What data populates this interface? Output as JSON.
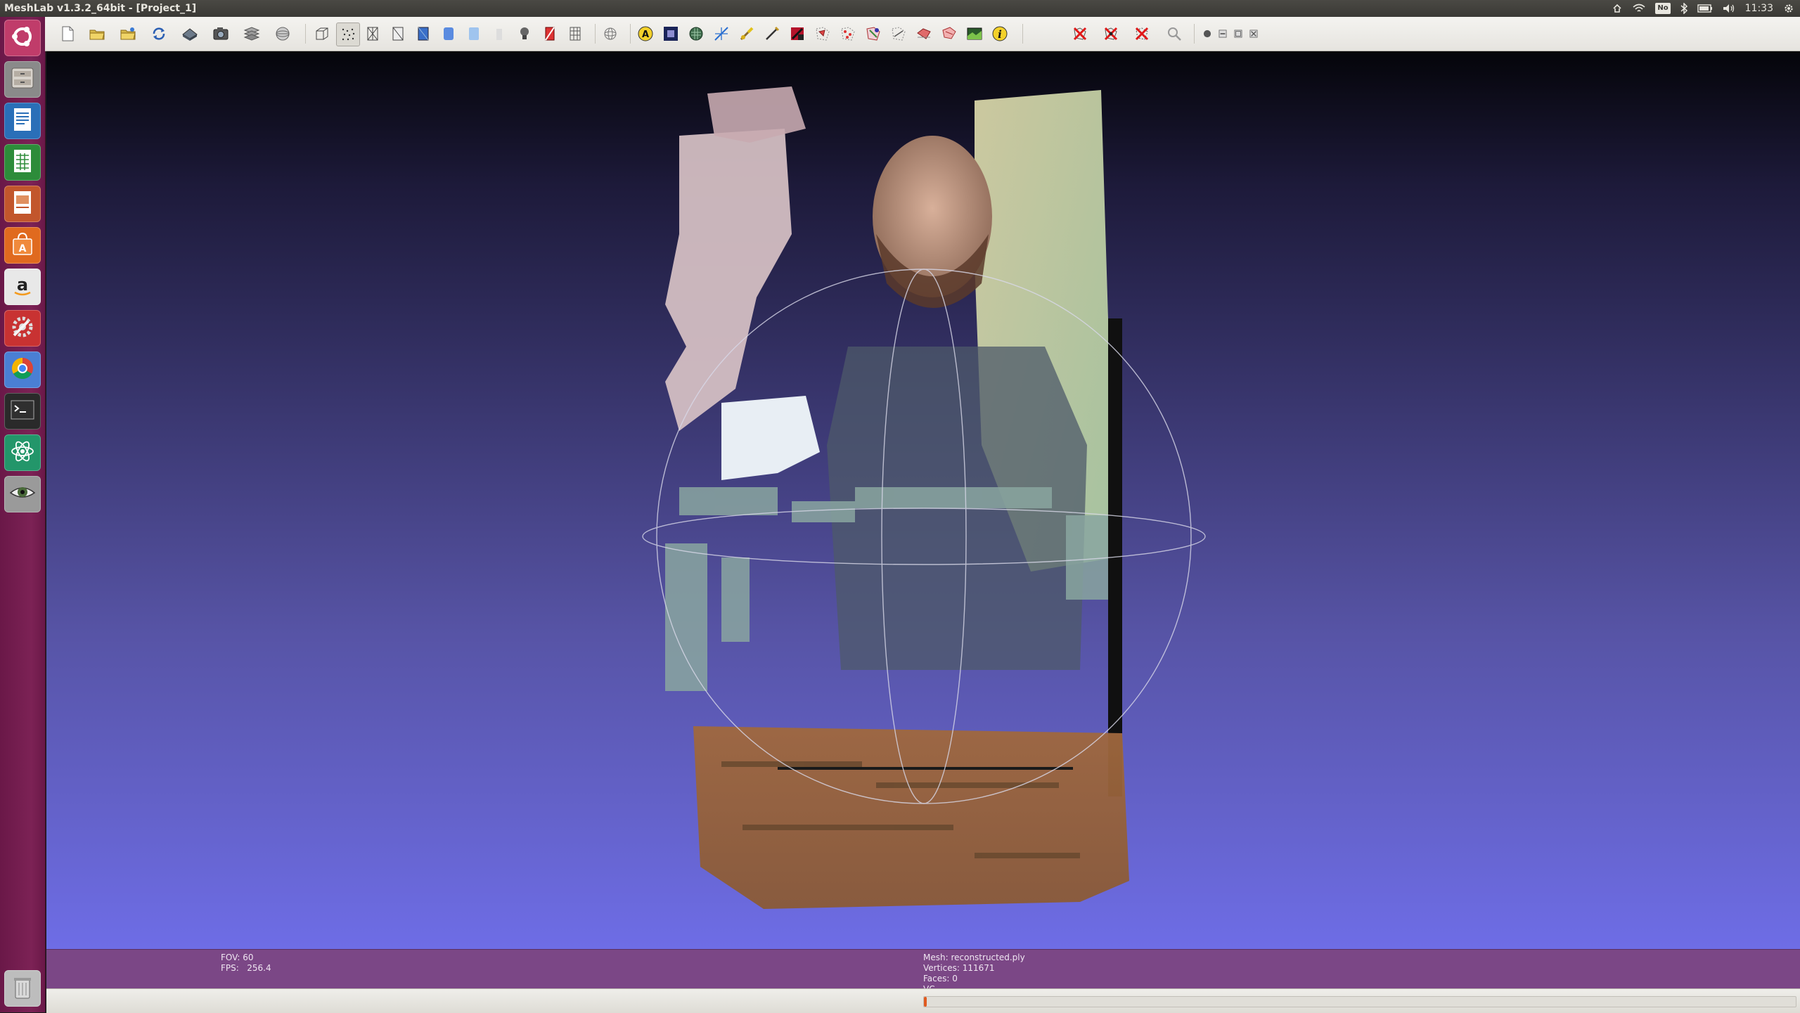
{
  "window": {
    "title": "MeshLab v1.3.2_64bit - [Project_1]"
  },
  "system_tray": {
    "items": [
      "network-settings-icon",
      "wifi-icon",
      "keyboard-layout-icon",
      "bluetooth-icon",
      "battery-icon",
      "volume-icon"
    ],
    "keyboard_layout": "No",
    "clock": "11:33"
  },
  "launcher": {
    "items": [
      {
        "name": "dash-home",
        "icon": "ubuntu-logo-icon",
        "color": "#c03c6a"
      },
      {
        "name": "files",
        "icon": "file-cabinet-icon",
        "color": "#8a8a8a"
      },
      {
        "name": "libreoffice-writer",
        "icon": "writer-document-icon",
        "color": "#2a6fb8"
      },
      {
        "name": "libreoffice-calc",
        "icon": "calc-spreadsheet-icon",
        "color": "#2d8c3a"
      },
      {
        "name": "libreoffice-impress",
        "icon": "impress-presentation-icon",
        "color": "#c2562c"
      },
      {
        "name": "ubuntu-software-center",
        "icon": "software-center-bag-icon",
        "color": "#e06a1f"
      },
      {
        "name": "amazon",
        "icon": "amazon-a-icon",
        "color": "#e8e8e8"
      },
      {
        "name": "system-settings",
        "icon": "wrench-gear-icon",
        "color": "#c83232"
      },
      {
        "name": "google-chrome",
        "icon": "chrome-icon",
        "color": "#4a7fd4"
      },
      {
        "name": "terminal",
        "icon": "terminal-prompt-icon",
        "color": "#2a2a2a"
      },
      {
        "name": "atom-like-app",
        "icon": "atom-icon",
        "color": "#23966a"
      },
      {
        "name": "meshlab",
        "icon": "eye-icon",
        "color": "#9a9a9a"
      },
      {
        "name": "trash",
        "icon": "trash-can-icon",
        "color": "#bdbdbd"
      }
    ]
  },
  "toolbar": {
    "groups": [
      [
        "new-file-icon",
        "open-folder-icon",
        "open-project-icon",
        "reload-icon",
        "save-icon",
        "snapshot-icon",
        "layers-icon",
        "align-icon"
      ],
      [
        "bounding-box-icon",
        "points-render-icon",
        "wireframe-icon",
        "hidden-lines-icon",
        "flat-shading-icon",
        "smooth-shading-icon",
        "texture-icon",
        "light-bulb-icon",
        "double-side-lighting-icon",
        "back-face-icon"
      ],
      [
        "trackball-icon"
      ],
      [
        "annotation-a-icon",
        "quality-mapper-icon",
        "mesh-info-icon",
        "measure-tool-icon",
        "paint-brush-icon",
        "pen-icon",
        "color-picker-icon",
        "select-faces-icon",
        "select-vertices-icon",
        "select-connected-icon",
        "select-region-icon",
        "fill-icon",
        "rubber-band-icon",
        "raster-icon",
        "info-i-icon"
      ],
      [
        "delete-faces-icon",
        "delete-vertices-icon",
        "delete-selection-icon",
        "zoom-icon"
      ],
      [
        "window-tile-icon",
        "window-min-icon",
        "window-restore-icon",
        "window-close-icon"
      ]
    ]
  },
  "info_panel": {
    "fov_label": "FOV: 60",
    "fps_label": "FPS:   256.4",
    "mesh_label": "Mesh: reconstructed.ply",
    "vertices_label": "Vertices: 111671",
    "faces_label": "Faces: 0",
    "vc_label": "VC"
  },
  "status": {
    "progress_percent": 0.3
  },
  "colors": {
    "launcher_bg": "#7c2255",
    "info_panel_bg": "#7b4786",
    "viewport_top": "#05050a",
    "viewport_bottom": "#6e6de6",
    "progress_fill": "#e05a20"
  }
}
